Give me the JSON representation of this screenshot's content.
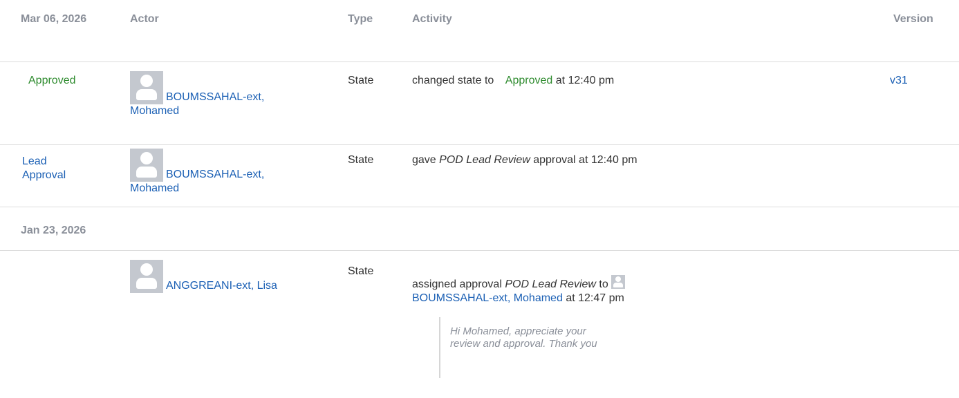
{
  "header": {
    "date": "Mar 06, 2026",
    "actor": "Actor",
    "type": "Type",
    "activity": "Activity",
    "version": "Version"
  },
  "rows": [
    {
      "label": "Approved",
      "actor_name": "BOUMSSAHAL-ext, Mohamed",
      "type": "State",
      "activity_pre": "changed state to",
      "activity_state": "Approved",
      "activity_post": "at 12:40 pm",
      "version": "v31"
    },
    {
      "label": "Lead Approval",
      "actor_name": "BOUMSSAHAL-ext, Mohamed",
      "type": "State",
      "activity_pre": "gave",
      "activity_em": "POD Lead Review",
      "activity_post": "approval at 12:40 pm"
    }
  ],
  "date_group_2": "Jan 23, 2026",
  "row3": {
    "actor_name": "ANGGREANI-ext, Lisa",
    "type": "State",
    "activity_pre": "assigned approval",
    "activity_em": "POD Lead Review",
    "activity_to": "to",
    "assignee": "BOUMSSAHAL-ext, Mohamed",
    "activity_post": "at 12:47 pm",
    "comment": "Hi Mohamed, appreciate your review and approval. Thank you"
  },
  "colors": {
    "link": "#1a5fb4",
    "state_green": "#2e8b2e",
    "header_gray": "#8a8f99",
    "divider": "#dcdcdc"
  },
  "icons": {
    "avatar": "user-avatar-icon"
  }
}
